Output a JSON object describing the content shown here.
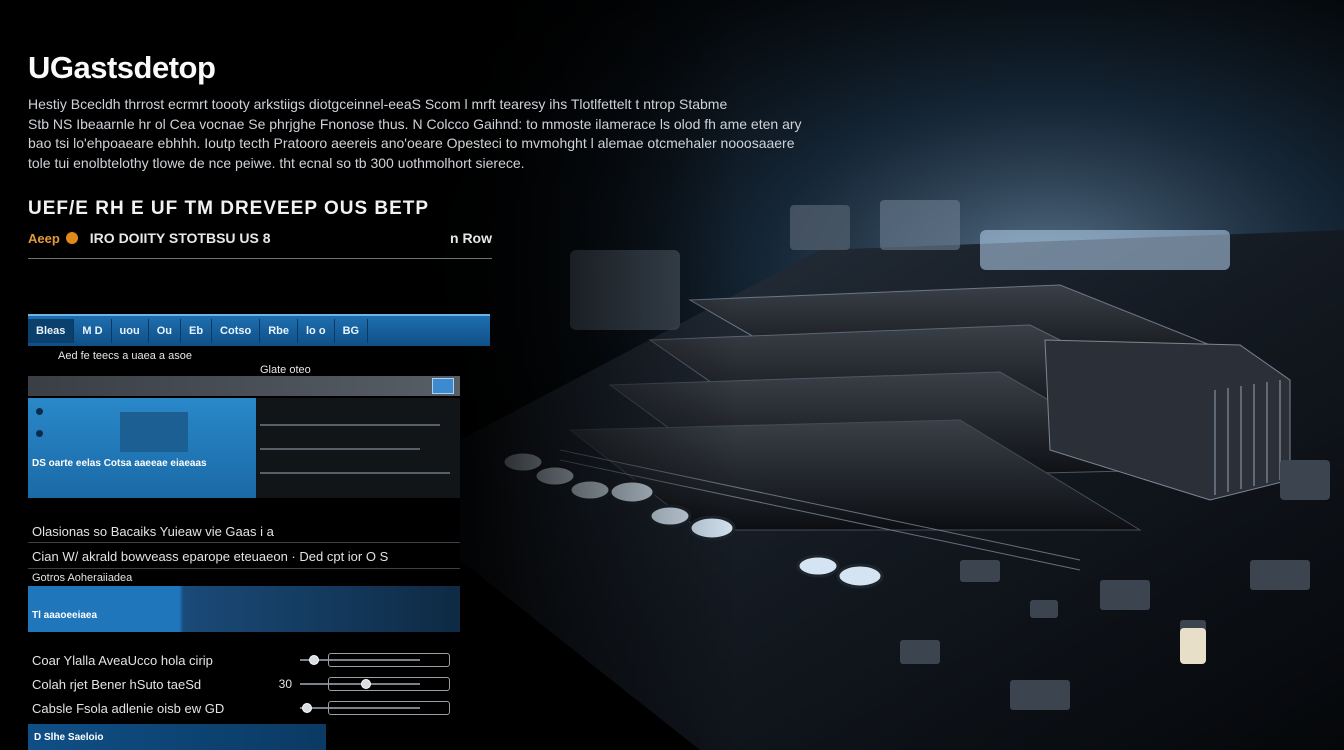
{
  "app": {
    "title": "UGastsdetop"
  },
  "intro": {
    "lines": [
      "Hestiy Bcecldh thrrost ecrmrt toooty arkstiigs diotgceinnel-eeaS Scom l mrft tearesy ihs Tlotlfettelt t ntrop Stabme",
      "Stb NS Ibeaarnle hr ol Cea vocnae Se phrjghe Fnonose thus. N Colcco Gaihnd: to mmoste ilamerace ls olod fh ame eten ary",
      "bao tsi lo'ehpoaeare ebhhh. Ioutp tecth Pratooro aeereis ano'oeare Opesteci to mvmohght l alemae otcmehaler nooosaaere",
      "tole tui enolbtelothy tlowe de nce peiwe. tht ecnal so tb 300 uothmolhort sierece."
    ]
  },
  "section": {
    "title": "UEF/E RH E UF TM DREVEEP OUS BETP",
    "tag": "Aeep",
    "subtitle": "IRO DOIITY STOTBSU US 8",
    "right": "n Row"
  },
  "panel": {
    "tabs": [
      "Bleas",
      "M D",
      "uou",
      "Ou",
      "Eb",
      "Cotso",
      "Rbe",
      "lo o",
      "BG"
    ],
    "row1": "Aed fe teecs     a uaea       a asoe",
    "row2": "Glate oteo",
    "pane_caption": "DS oarte eelas Cotsa aaeeae eiaeaas",
    "settings": [
      "Olasionas so Bacaiks  Yuieaw vie Gaas i  a",
      "Cian W/ akrald bowveass eparope eteuaeon · Ded cpt ior O S",
      "Gotros Aoheraiiadea"
    ],
    "bluebar_label": "Tl aaaoeeiaea",
    "sliders": [
      {
        "label": "Coar  Ylalla AveaUcco hola cirip",
        "value": "",
        "knob": 0.08
      },
      {
        "label": "Colah rjet Bener hSuto taeSd",
        "value": "30",
        "knob": 0.55
      },
      {
        "label": "Cabsle  Fsola adlenie oisb ew GD",
        "value": "",
        "knob": 0.02
      }
    ],
    "footer_label": "D Slhe Saeloio"
  },
  "colors": {
    "accent": "#1f76bb",
    "accent_dark": "#0f4f86",
    "tag": "#e39a3b",
    "background": "#000000"
  }
}
